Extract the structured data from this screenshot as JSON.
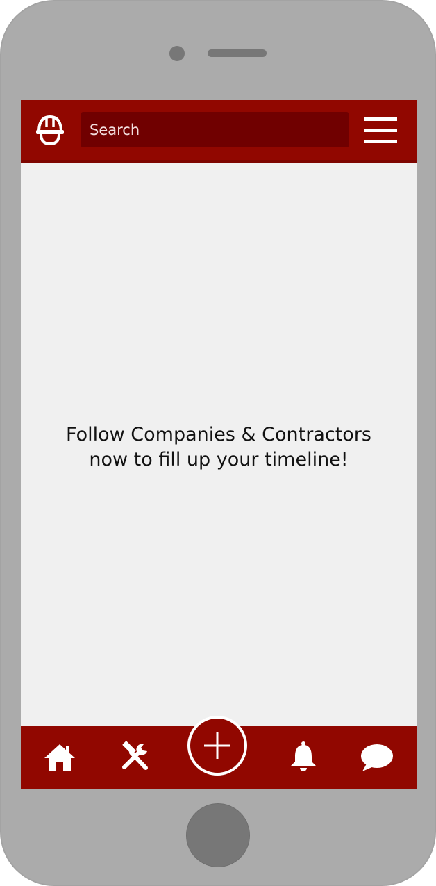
{
  "header": {
    "logo_icon": "hard-hat-icon",
    "search": {
      "placeholder": "Search"
    },
    "menu_icon": "hamburger-menu-icon"
  },
  "timeline": {
    "empty_message_line1": "Follow Companies & Contractors",
    "empty_message_line2": "now to fill up your timeline!"
  },
  "bottom_nav": {
    "items": [
      {
        "icon": "home-icon"
      },
      {
        "icon": "tools-icon"
      },
      {
        "icon": "plus-icon"
      },
      {
        "icon": "bell-icon"
      },
      {
        "icon": "chat-bubble-icon"
      }
    ]
  },
  "colors": {
    "brand_red": "#910700",
    "search_bg": "#700000",
    "screen_bg": "#f0f0f0",
    "phone_body": "#ababab"
  }
}
